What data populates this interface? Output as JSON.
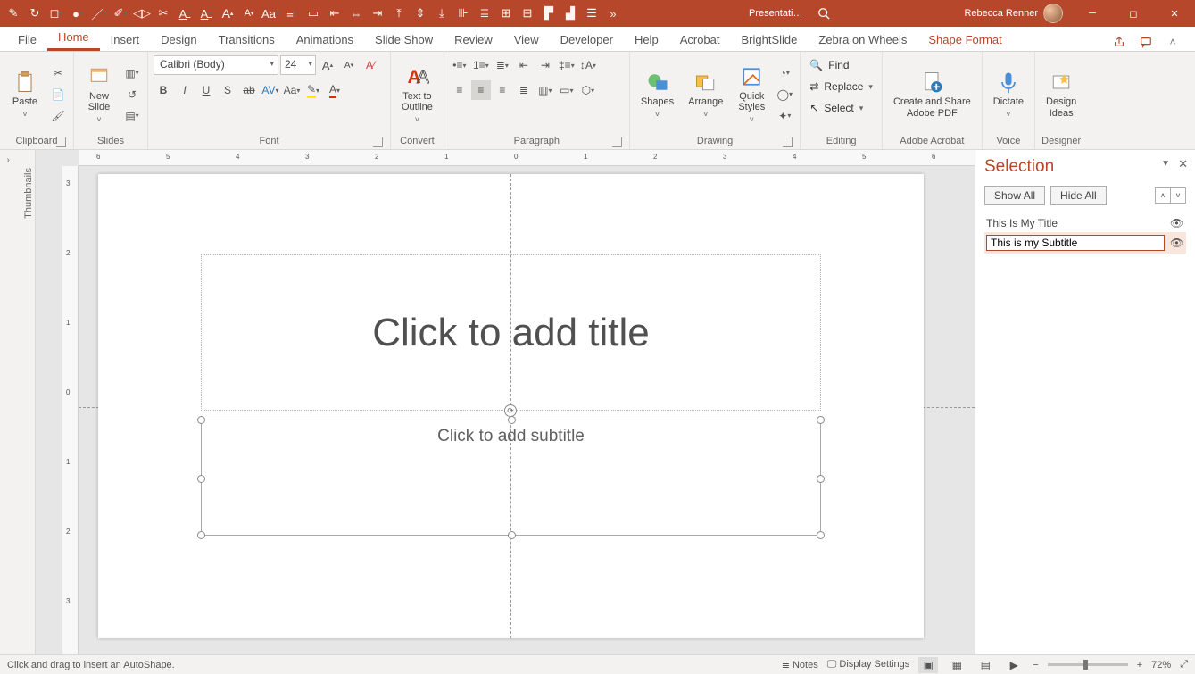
{
  "title": {
    "doc": "Presentati…",
    "user": "Rebecca Renner"
  },
  "tabs": [
    "File",
    "Home",
    "Insert",
    "Design",
    "Transitions",
    "Animations",
    "Slide Show",
    "Review",
    "View",
    "Developer",
    "Help",
    "Acrobat",
    "BrightSlide",
    "Zebra on Wheels",
    "Shape Format"
  ],
  "active_tab": "Home",
  "special_tab": "Shape Format",
  "ribbon": {
    "clipboard": {
      "label": "Clipboard",
      "paste": "Paste"
    },
    "slides": {
      "label": "Slides",
      "new_slide": "New\nSlide"
    },
    "font": {
      "label": "Font",
      "name": "Calibri (Body)",
      "size": "24"
    },
    "convert": {
      "label": "Convert",
      "text_to_outline": "Text to\nOutline"
    },
    "paragraph": {
      "label": "Paragraph"
    },
    "drawing": {
      "label": "Drawing",
      "shapes": "Shapes",
      "arrange": "Arrange",
      "quick": "Quick\nStyles"
    },
    "editing": {
      "label": "Editing",
      "find": "Find",
      "replace": "Replace",
      "select": "Select"
    },
    "acrobat": {
      "label": "Adobe Acrobat",
      "btn": "Create and Share\nAdobe PDF"
    },
    "voice": {
      "label": "Voice",
      "dictate": "Dictate"
    },
    "designer": {
      "label": "Designer",
      "ideas": "Design\nIdeas"
    }
  },
  "thumbnails_label": "Thumbnails",
  "slide": {
    "title_ph": "Click to add title",
    "sub_ph": "Click to add subtitle"
  },
  "ruler": {
    "h": [
      "6",
      "5",
      "4",
      "3",
      "2",
      "1",
      "0",
      "1",
      "2",
      "3",
      "4",
      "5",
      "6"
    ],
    "v": [
      "3",
      "2",
      "1",
      "0",
      "1",
      "2",
      "3"
    ]
  },
  "selection": {
    "title": "Selection",
    "show_all": "Show All",
    "hide_all": "Hide All",
    "items": [
      {
        "name": "This Is My Title",
        "editing": false
      },
      {
        "name": "This is my Subtitle",
        "editing": true
      }
    ]
  },
  "status": {
    "msg": "Click and drag to insert an AutoShape.",
    "notes": "Notes",
    "display": "Display Settings",
    "zoom": "72%"
  }
}
